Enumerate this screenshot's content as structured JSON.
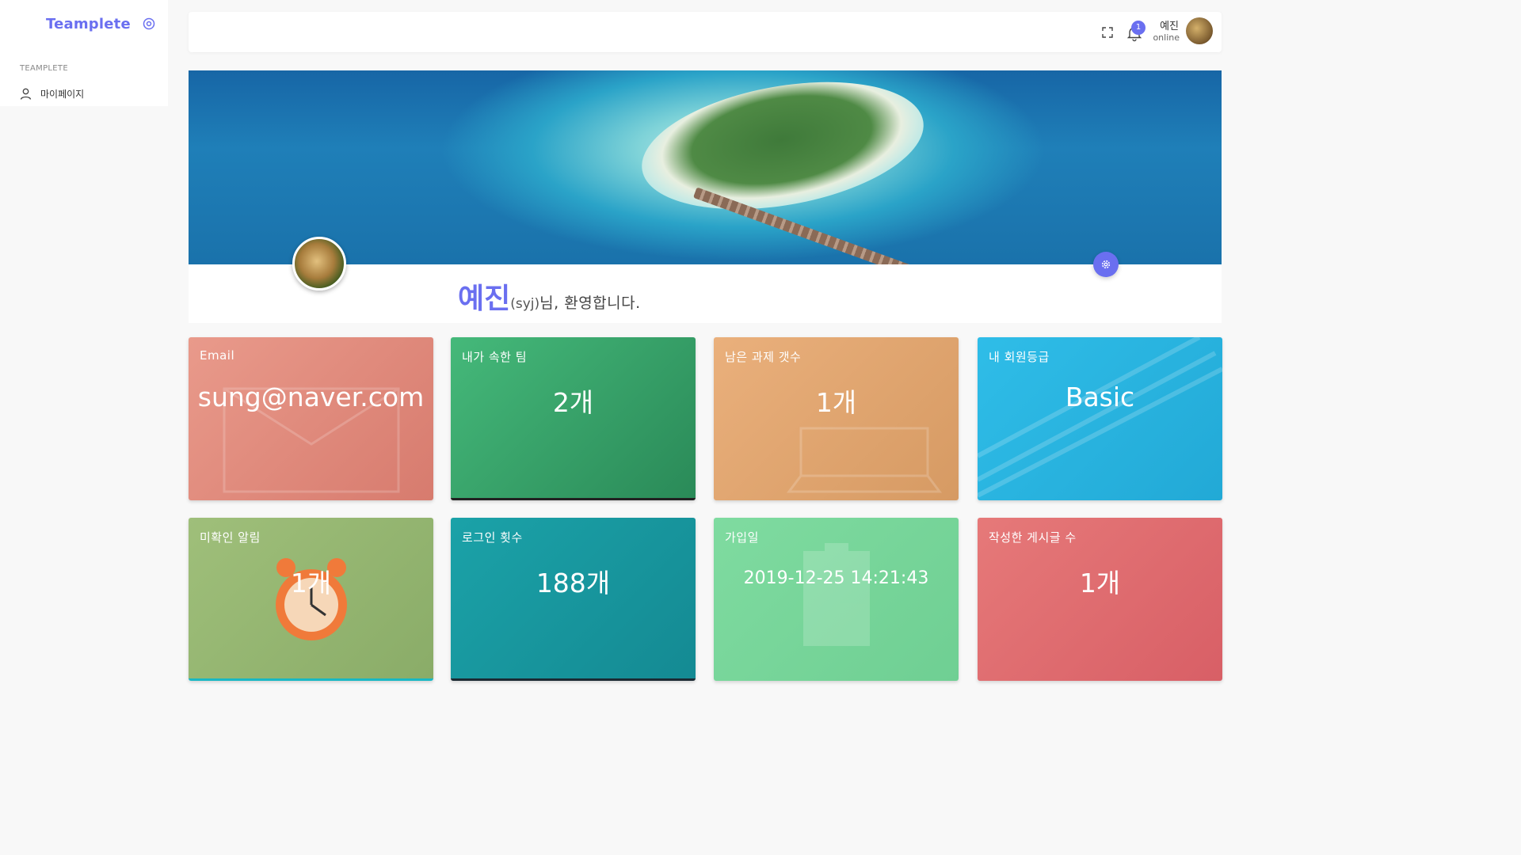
{
  "sidebar": {
    "brand": "Teamplete",
    "section_title": "TEAMPLETE",
    "items": [
      {
        "label": "마이페이지",
        "icon": "user-icon"
      }
    ]
  },
  "topbar": {
    "notification_count": "1",
    "user_name": "예진",
    "user_status": "online"
  },
  "profile": {
    "name": "예진",
    "id": "(syj)",
    "welcome": "님, 환영합니다."
  },
  "cards": [
    {
      "label": "Email",
      "value": "sung@naver.com",
      "color": "#e08f80"
    },
    {
      "label": "내가 속한 팀",
      "value": "2개",
      "color": "#3aa86c"
    },
    {
      "label": "남은 과제 갯수",
      "value": "1개",
      "color": "#e2a672"
    },
    {
      "label": "내 회원등급",
      "value": "Basic",
      "color": "#2ab6e2"
    },
    {
      "label": "미확인 알림",
      "value": "1개",
      "color": "#97b873"
    },
    {
      "label": "로그인 횟수",
      "value": "188개",
      "color": "#1899a0"
    },
    {
      "label": "가입일",
      "value": "2019-12-25 14:21:43",
      "color": "#78d69b"
    },
    {
      "label": "작성한 게시글 수",
      "value": "1개",
      "color": "#e06d70"
    }
  ],
  "colors": {
    "accent": "#6a6ff0"
  }
}
